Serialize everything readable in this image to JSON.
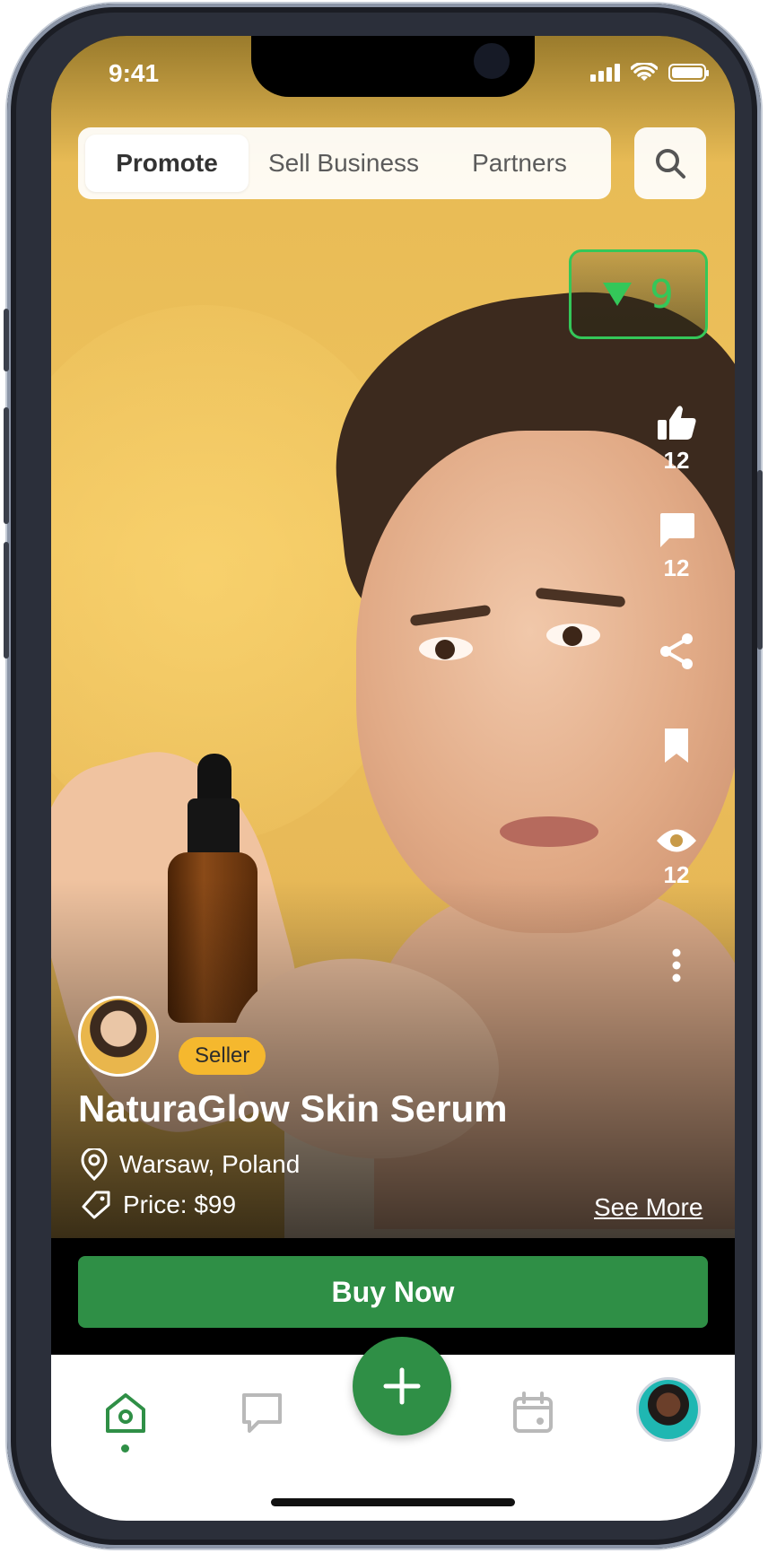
{
  "status_bar": {
    "time": "9:41"
  },
  "top_tabs": {
    "items": [
      {
        "label": "Promote",
        "active": true
      },
      {
        "label": "Sell Business",
        "active": false
      },
      {
        "label": "Partners",
        "active": false
      }
    ],
    "search_icon": "search-icon"
  },
  "counter": {
    "icon": "triangle-down-icon",
    "value": "9",
    "color": "#34c759"
  },
  "actions": {
    "like": {
      "icon": "thumbs-up-icon",
      "count": "12"
    },
    "comment": {
      "icon": "comment-icon",
      "count": "12"
    },
    "share": {
      "icon": "share-icon"
    },
    "bookmark": {
      "icon": "bookmark-icon"
    },
    "views": {
      "icon": "eye-icon",
      "count": "12"
    },
    "more": {
      "icon": "more-vertical-icon"
    }
  },
  "listing": {
    "seller_badge": "Seller",
    "title": "NaturaGlow Skin Serum",
    "location": "Warsaw, Poland",
    "price": "Price: $99",
    "see_more": "See More"
  },
  "cta": {
    "buy_now": "Buy Now",
    "color": "#2f8f46"
  },
  "bottom_nav": {
    "items": [
      "home-icon",
      "chat-icon",
      "add-icon",
      "calendar-icon",
      "profile-avatar"
    ],
    "active": "home-icon"
  }
}
